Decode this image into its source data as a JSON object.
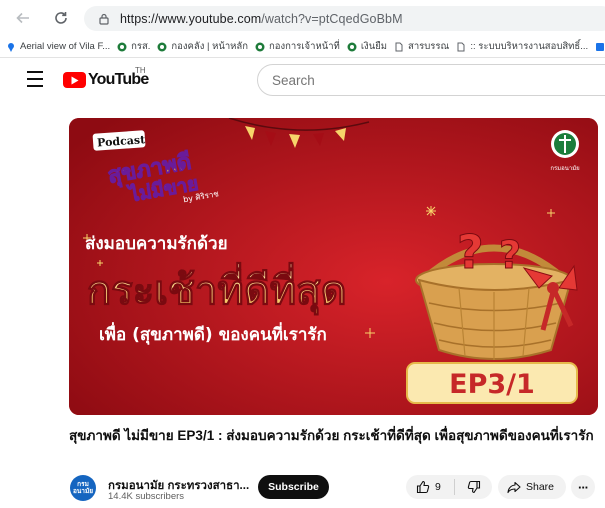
{
  "browser": {
    "url_host": "https://www.youtube.com",
    "url_path": "/watch?v=ptCqedGoBbM"
  },
  "bookmarks": [
    {
      "label": "Aerial view of Vila F...",
      "icon": "map-pin-icon"
    },
    {
      "label": "กรส.",
      "icon": "moph-favicon"
    },
    {
      "label": "กองคลัง | หน้าหลัก",
      "icon": "moph-favicon"
    },
    {
      "label": "กองการเจ้าหน้าที่",
      "icon": "moph-favicon"
    },
    {
      "label": "เงินยืม",
      "icon": "moph-favicon"
    },
    {
      "label": "สารบรรณ",
      "icon": "page-icon"
    },
    {
      "label": ":: ระบบบริหารงานสอบสิทธิ์...",
      "icon": "page-icon"
    },
    {
      "label": "กร",
      "icon": "web-icon"
    }
  ],
  "youtube": {
    "logo_text": "YouTube",
    "logo_region": "TH",
    "search_placeholder": "Search"
  },
  "thumbnail": {
    "badge": "Podcast",
    "show_title_line1": "สุขภาพดี",
    "show_title_line2": "ไม่มีขาย",
    "show_title_sub": "by ศิริราช",
    "line1": "ส่งมอบความรักด้วย",
    "line2": "กระเช้าที่ดีที่สุด",
    "line3": "เพื่อ (สุขภาพดี) ของคนที่เรารัก",
    "episode": "EP3/1",
    "org_logo_text": "กรมอนามัย"
  },
  "video": {
    "title": "สุขภาพดี ไม่มีขาย EP3/1 : ส่งมอบความรักด้วย กระเช้าที่ดีที่สุด เพื่อสุขภาพดีของคนที่เรารัก",
    "channel_name": "กรมอนามัย กระทรวงสาธา...",
    "subscribers": "14.4K subscribers",
    "avatar_line1": "กรม",
    "avatar_line2": "อนามัย",
    "subscribe_label": "Subscribe",
    "likes": "9",
    "share_label": "Share",
    "more_label": "···"
  },
  "colors": {
    "thumb_red": "#c4161c",
    "thumb_gold": "#f7d46a",
    "yt_red": "#ff0000"
  }
}
